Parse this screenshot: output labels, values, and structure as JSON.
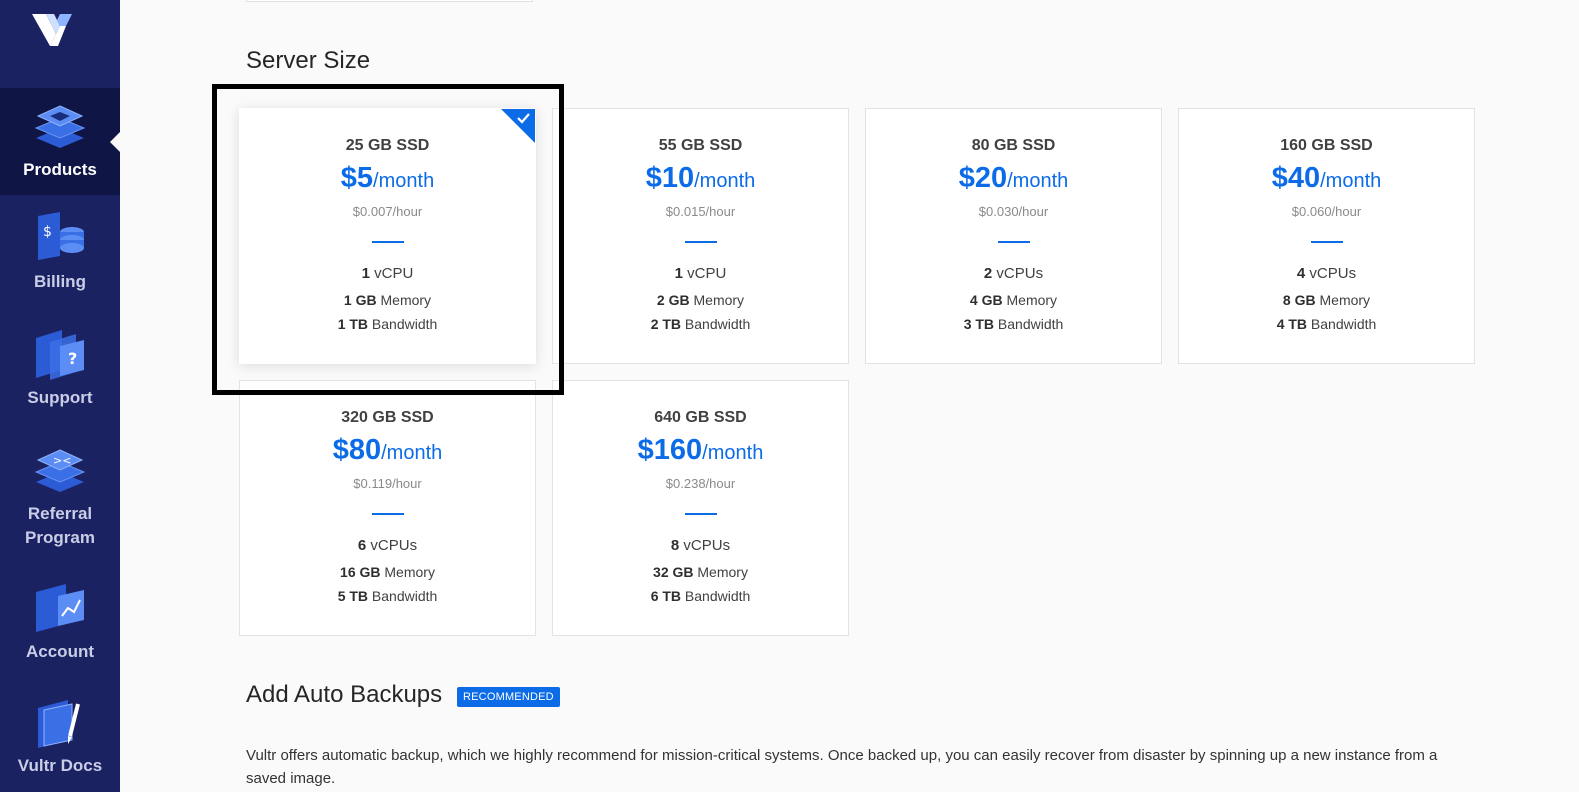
{
  "sidebar": {
    "logo_icon": "vultr-logo-icon",
    "items": [
      {
        "label": "Products",
        "icon": "products-stack-icon",
        "active": true
      },
      {
        "label": "Billing",
        "icon": "billing-coins-icon",
        "active": false
      },
      {
        "label": "Support",
        "icon": "support-question-icon",
        "active": false
      },
      {
        "label": "Referral\nProgram",
        "icon": "referral-icon",
        "active": false
      },
      {
        "label": "Account",
        "icon": "account-chart-icon",
        "active": false
      },
      {
        "label": "Vultr Docs",
        "icon": "docs-pen-icon",
        "active": false
      }
    ]
  },
  "server_size": {
    "title": "Server Size",
    "plans": [
      {
        "ssd": "25 GB SSD",
        "price": "$5",
        "per": "/month",
        "hourly": "$0.007/hour",
        "cpu_num": "1",
        "cpu_unit": "vCPU",
        "mem_num": "1 GB",
        "mem_unit": "Memory",
        "bw_num": "1 TB",
        "bw_unit": "Bandwidth",
        "selected": true
      },
      {
        "ssd": "55 GB SSD",
        "price": "$10",
        "per": "/month",
        "hourly": "$0.015/hour",
        "cpu_num": "1",
        "cpu_unit": "vCPU",
        "mem_num": "2 GB",
        "mem_unit": "Memory",
        "bw_num": "2 TB",
        "bw_unit": "Bandwidth",
        "selected": false
      },
      {
        "ssd": "80 GB SSD",
        "price": "$20",
        "per": "/month",
        "hourly": "$0.030/hour",
        "cpu_num": "2",
        "cpu_unit": "vCPUs",
        "mem_num": "4 GB",
        "mem_unit": "Memory",
        "bw_num": "3 TB",
        "bw_unit": "Bandwidth",
        "selected": false
      },
      {
        "ssd": "160 GB SSD",
        "price": "$40",
        "per": "/month",
        "hourly": "$0.060/hour",
        "cpu_num": "4",
        "cpu_unit": "vCPUs",
        "mem_num": "8 GB",
        "mem_unit": "Memory",
        "bw_num": "4 TB",
        "bw_unit": "Bandwidth",
        "selected": false
      },
      {
        "ssd": "320 GB SSD",
        "price": "$80",
        "per": "/month",
        "hourly": "$0.119/hour",
        "cpu_num": "6",
        "cpu_unit": "vCPUs",
        "mem_num": "16 GB",
        "mem_unit": "Memory",
        "bw_num": "5 TB",
        "bw_unit": "Bandwidth",
        "selected": false
      },
      {
        "ssd": "640 GB SSD",
        "price": "$160",
        "per": "/month",
        "hourly": "$0.238/hour",
        "cpu_num": "8",
        "cpu_unit": "vCPUs",
        "mem_num": "32 GB",
        "mem_unit": "Memory",
        "bw_num": "6 TB",
        "bw_unit": "Bandwidth",
        "selected": false
      }
    ]
  },
  "auto_backups": {
    "title": "Add Auto Backups",
    "badge": "RECOMMENDED",
    "description": "Vultr offers automatic backup, which we highly recommend for mission-critical systems. Once backed up, you can easily recover from disaster by spinning up a new instance from a saved image."
  },
  "colors": {
    "accent": "#0c6ce8",
    "sidebar": "#1b2262",
    "sidebar_active": "#0f1545"
  }
}
